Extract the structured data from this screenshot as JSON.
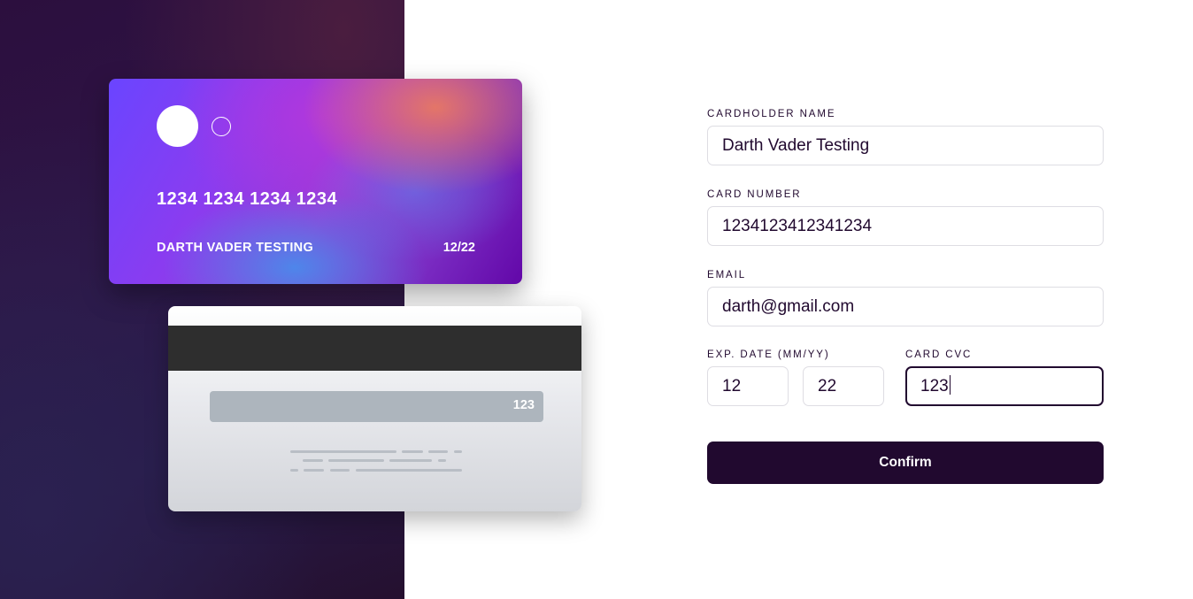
{
  "card_front": {
    "number": "1234 1234 1234 1234",
    "name": "DARTH VADER TESTING",
    "expiry": "12/22"
  },
  "card_back": {
    "cvc": "123"
  },
  "form": {
    "cardholder_name": {
      "label": "Cardholder Name",
      "value": "Darth Vader Testing"
    },
    "card_number": {
      "label": "Card Number",
      "value": "1234123412341234"
    },
    "email": {
      "label": "Email",
      "value": "darth@gmail.com"
    },
    "exp_date": {
      "label": "Exp. Date (MM/YY)",
      "month": "12",
      "year": "22"
    },
    "cvc": {
      "label": "Card CVC",
      "value": "123"
    },
    "confirm_label": "Confirm"
  },
  "colors": {
    "primary_dark": "#21092f",
    "input_border": "#dedde3",
    "card_stripe": "#2e2e2e",
    "signature_strip": "#adb5bd"
  }
}
